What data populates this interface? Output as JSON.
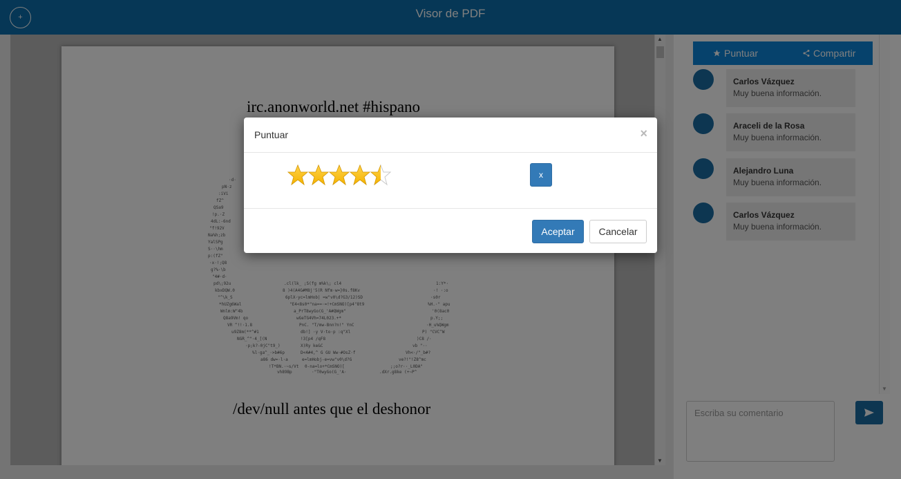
{
  "header": {
    "title": "Visor de PDF",
    "add_label": "+"
  },
  "pdf": {
    "line1": "irc.anonworld.net #hispano",
    "line2": "/dev/null antes que el deshonor"
  },
  "sidebar": {
    "tabs": [
      {
        "label": "Puntuar",
        "icon": "star-icon"
      },
      {
        "label": "Compartir",
        "icon": "share-icon"
      }
    ],
    "comments": [
      {
        "author": "Carlos Vázquez",
        "text": "Muy buena información."
      },
      {
        "author": "Araceli de la Rosa",
        "text": "Muy buena información."
      },
      {
        "author": "Alejandro Luna",
        "text": "Muy buena información."
      },
      {
        "author": "Carlos Vázquez",
        "text": "Muy buena información."
      }
    ],
    "comment_placeholder": "Escriba su comentario",
    "send_icon": "send-icon"
  },
  "modal": {
    "title": "Puntuar",
    "close_label": "×",
    "rating": 4.5,
    "max_rating": 5,
    "clear_label": "x",
    "accept_label": "Aceptar",
    "cancel_label": "Cancelar"
  },
  "colors": {
    "header": "#0d6fad",
    "tab_bar": "#0d85d8",
    "primary": "#337ab7",
    "avatar": "#1b6ca3",
    "star": "#f5b400"
  }
}
